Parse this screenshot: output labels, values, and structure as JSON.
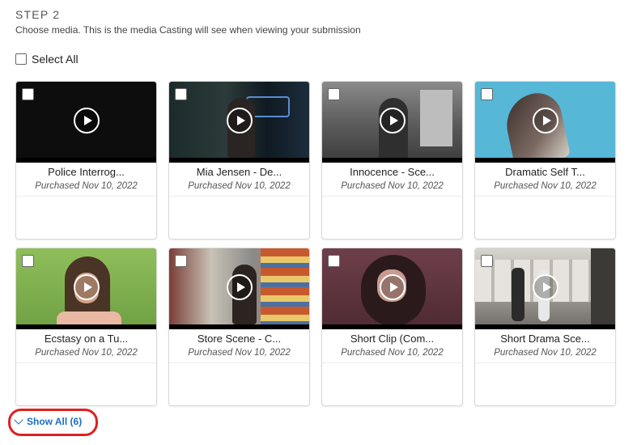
{
  "step": {
    "title": "STEP 2",
    "description": "Choose media. This is the media Casting will see when viewing your submission"
  },
  "select_all": {
    "label": "Select All",
    "checked": false
  },
  "media": [
    {
      "title": "Police Interrog...",
      "date": "Purchased Nov 10, 2022",
      "checked": false
    },
    {
      "title": "Mia Jensen - De...",
      "date": "Purchased Nov 10, 2022",
      "checked": false
    },
    {
      "title": "Innocence - Sce...",
      "date": "Purchased Nov 10, 2022",
      "checked": false
    },
    {
      "title": "Dramatic Self T...",
      "date": "Purchased Nov 10, 2022",
      "checked": false
    },
    {
      "title": "Ecstasy on a Tu...",
      "date": "Purchased Nov 10, 2022",
      "checked": false
    },
    {
      "title": "Store Scene - C...",
      "date": "Purchased Nov 10, 2022",
      "checked": false
    },
    {
      "title": "Short Clip (Com...",
      "date": "Purchased Nov 10, 2022",
      "checked": false
    },
    {
      "title": "Short Drama Sce...",
      "date": "Purchased Nov 10, 2022",
      "checked": false
    }
  ],
  "show_all": {
    "label": "Show All (6)",
    "icon": "chevron-down-icon"
  },
  "colors": {
    "link": "#1a6fc8",
    "highlight": "#e02020"
  }
}
